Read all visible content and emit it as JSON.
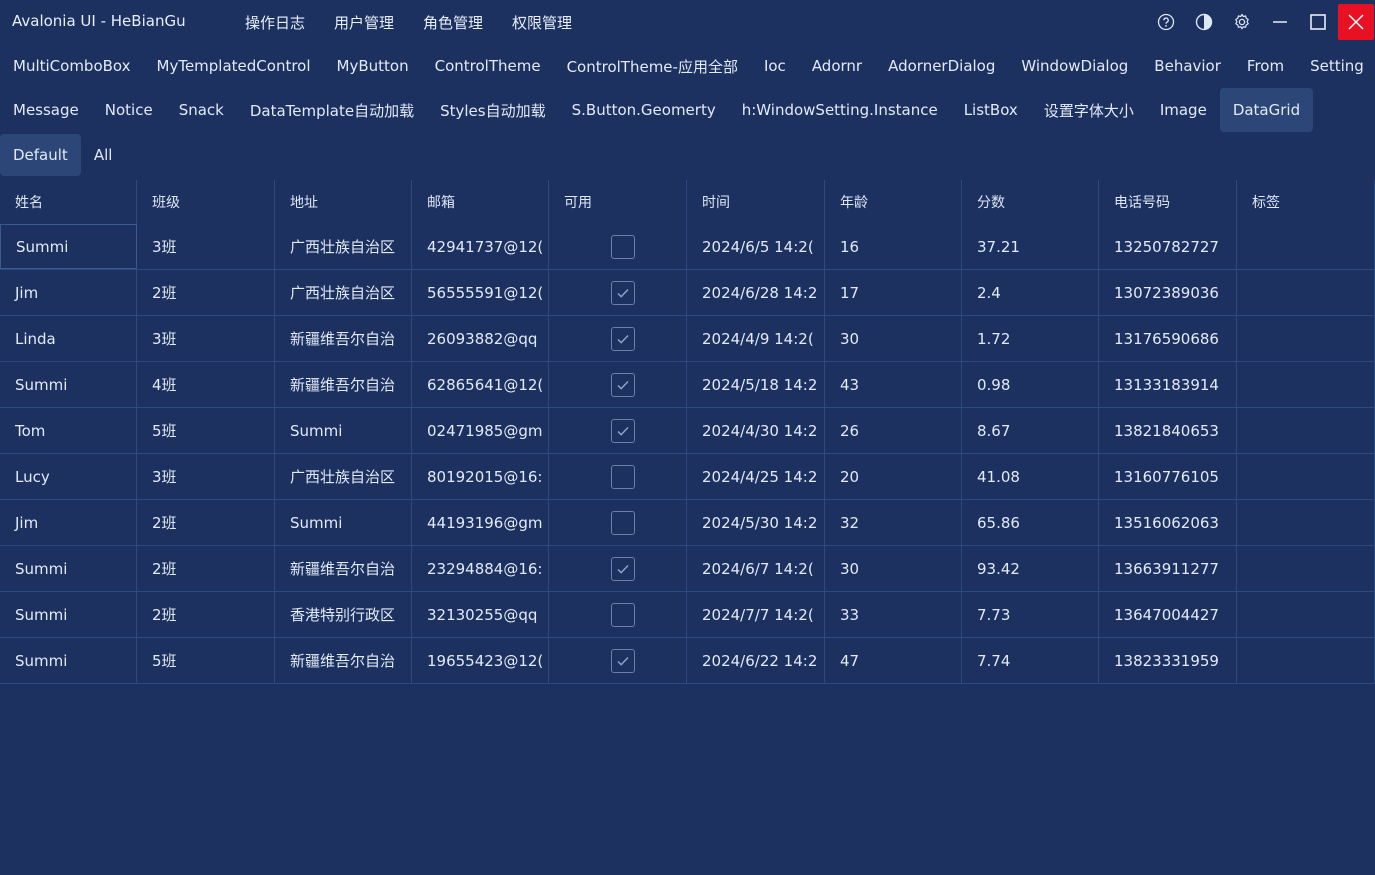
{
  "window": {
    "title": "Avalonia UI - HeBianGu"
  },
  "top_menu": [
    "操作日志",
    "用户管理",
    "角色管理",
    "权限管理"
  ],
  "controls": {
    "help": "help-icon",
    "theme": "contrast-icon",
    "settings": "gear-icon",
    "minimize": "minimize-icon",
    "maximize": "maximize-icon",
    "close": "close-icon",
    "close_color": "#e81123"
  },
  "tabs_row1": [
    "MultiComboBox",
    "MyTemplatedControl",
    "MyButton",
    "ControlTheme",
    "ControlTheme-应用全部",
    "Ioc",
    "Adornr",
    "AdornerDialog",
    "WindowDialog",
    "Behavior",
    "From",
    "Setting"
  ],
  "tabs_row2": [
    "Message",
    "Notice",
    "Snack",
    "DataTemplate自动加载",
    "Styles自动加载",
    "S.Button.Geomerty",
    "h:WindowSetting.Instance",
    "ListBox",
    "设置字体大小",
    "Image",
    "DataGrid"
  ],
  "active_tab": "DataGrid",
  "subtabs": [
    "Default",
    "All"
  ],
  "active_subtab": "Default",
  "grid": {
    "columns": [
      "姓名",
      "班级",
      "地址",
      "邮箱",
      "可用",
      "时间",
      "年龄",
      "分数",
      "电话号码",
      "标签"
    ],
    "rows": [
      [
        "Summi",
        "3班",
        "广西壮族自治区",
        "42941737@12(",
        false,
        "2024/6/5 14:2(",
        "16",
        "37.21",
        "13250782727",
        ""
      ],
      [
        "Jim",
        "2班",
        "广西壮族自治区",
        "56555591@12(",
        true,
        "2024/6/28 14:2",
        "17",
        "2.4",
        "13072389036",
        ""
      ],
      [
        "Linda",
        "3班",
        "新疆维吾尔自治",
        "26093882@qq",
        true,
        "2024/4/9 14:2(",
        "30",
        "1.72",
        "13176590686",
        ""
      ],
      [
        "Summi",
        "4班",
        "新疆维吾尔自治",
        "62865641@12(",
        true,
        "2024/5/18 14:2",
        "43",
        "0.98",
        "13133183914",
        ""
      ],
      [
        "Tom",
        "5班",
        "Summi",
        "02471985@gm",
        true,
        "2024/4/30 14:2",
        "26",
        "8.67",
        "13821840653",
        ""
      ],
      [
        "Lucy",
        "3班",
        "广西壮族自治区",
        "80192015@16:",
        false,
        "2024/4/25 14:2",
        "20",
        "41.08",
        "13160776105",
        ""
      ],
      [
        "Jim",
        "2班",
        "Summi",
        "44193196@gm",
        false,
        "2024/5/30 14:2",
        "32",
        "65.86",
        "13516062063",
        ""
      ],
      [
        "Summi",
        "2班",
        "新疆维吾尔自治",
        "23294884@16:",
        true,
        "2024/6/7 14:2(",
        "30",
        "93.42",
        "13663911277",
        ""
      ],
      [
        "Summi",
        "2班",
        "香港特别行政区",
        "32130255@qq",
        false,
        "2024/7/7 14:2(",
        "33",
        "7.73",
        "13647004427",
        ""
      ],
      [
        "Summi",
        "5班",
        "新疆维吾尔自治",
        "19655423@12(",
        true,
        "2024/6/22 14:2",
        "47",
        "7.74",
        "13823331959",
        ""
      ]
    ]
  }
}
